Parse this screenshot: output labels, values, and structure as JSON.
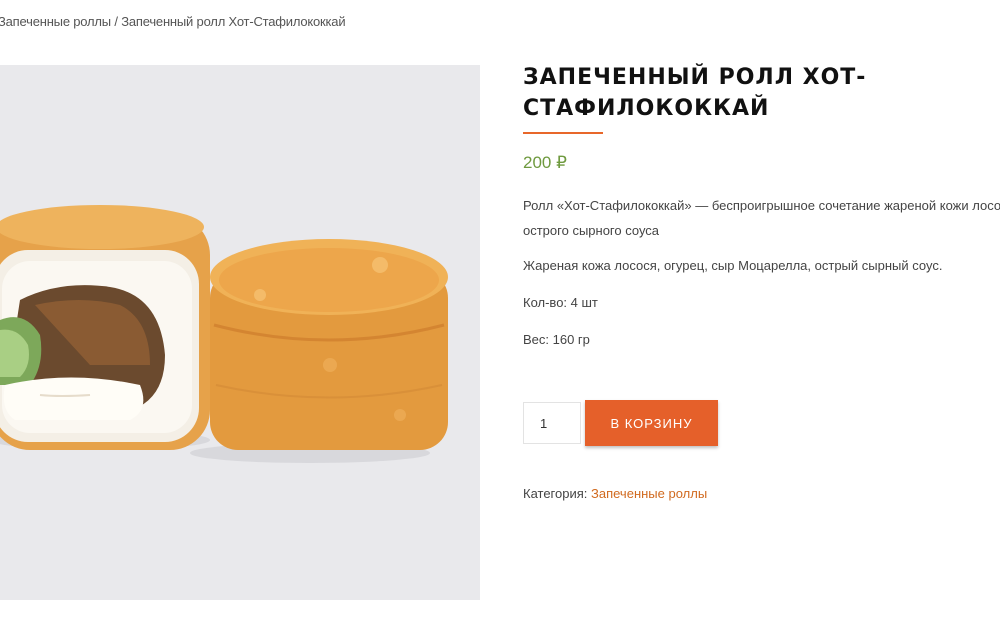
{
  "breadcrumb": {
    "items": [
      "Запеченные роллы",
      "Запеченный ролл Хот-Стафилококкай"
    ],
    "separator": "/"
  },
  "product": {
    "image_alt": "Запеченный ролл Хот-Стафилококкай",
    "title": "Запеченный ролл Хот-Стафилококкай",
    "price": "200 ₽",
    "description_line1": "Ролл «Хот-Стафилококкай» — беспроигрышное сочетание жареной кожи лосося",
    "description_line2": "острого сырного соуса",
    "ingredients": "Жареная кожа лосося, огурец, сыр Моцарелла, острый сырный соус.",
    "count": "Кол-во: 4 шт",
    "weight": "Вес: 160 гр",
    "quantity_value": "1",
    "add_to_cart_label": "В корзину",
    "category_label": "Категория:",
    "category_link": "Запеченные роллы"
  },
  "colors": {
    "accent": "#e5602a",
    "price": "#6f9a3f",
    "link": "#d16a1f"
  }
}
